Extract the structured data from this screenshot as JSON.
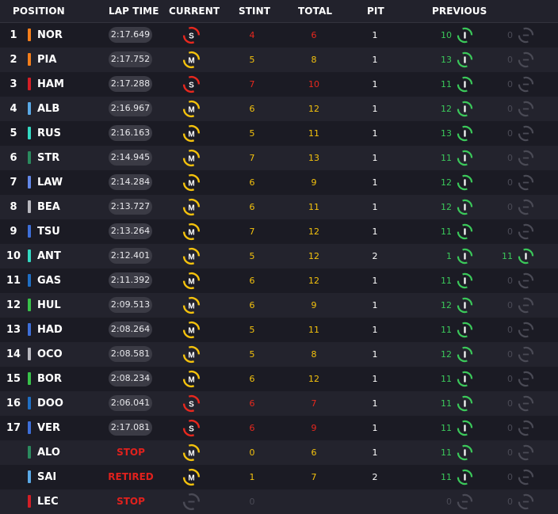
{
  "header": {
    "position": "POSITION",
    "lap_time": "LAP TIME",
    "current": "CURRENT",
    "stint": "STINT",
    "total": "TOTAL",
    "pit": "PIT",
    "previous": "PREVIOUS"
  },
  "colors": {
    "soft": "#e8281e",
    "medium": "#f4c20d",
    "inter": "#3bc85a",
    "dim": "#4a4a55"
  },
  "rows": [
    {
      "pos": "1",
      "code": "NOR",
      "team_color": "#f47e1b",
      "lap": "2:17.649",
      "tyre": "S",
      "stint": "4",
      "total": "6",
      "pit": "1",
      "p1_lap": "10",
      "p1_tyre": "I",
      "p2_lap": "0",
      "p2_tyre": ""
    },
    {
      "pos": "2",
      "code": "PIA",
      "team_color": "#f47e1b",
      "lap": "2:17.752",
      "tyre": "M",
      "stint": "5",
      "total": "8",
      "pit": "1",
      "p1_lap": "13",
      "p1_tyre": "I",
      "p2_lap": "0",
      "p2_tyre": ""
    },
    {
      "pos": "3",
      "code": "HAM",
      "team_color": "#d31e26",
      "lap": "2:17.288",
      "tyre": "S",
      "stint": "7",
      "total": "10",
      "pit": "1",
      "p1_lap": "11",
      "p1_tyre": "I",
      "p2_lap": "0",
      "p2_tyre": ""
    },
    {
      "pos": "4",
      "code": "ALB",
      "team_color": "#5aa9e6",
      "lap": "2:16.967",
      "tyre": "M",
      "stint": "6",
      "total": "12",
      "pit": "1",
      "p1_lap": "12",
      "p1_tyre": "I",
      "p2_lap": "0",
      "p2_tyre": ""
    },
    {
      "pos": "5",
      "code": "RUS",
      "team_color": "#33d9c2",
      "lap": "2:16.163",
      "tyre": "M",
      "stint": "5",
      "total": "11",
      "pit": "1",
      "p1_lap": "13",
      "p1_tyre": "I",
      "p2_lap": "0",
      "p2_tyre": ""
    },
    {
      "pos": "6",
      "code": "STR",
      "team_color": "#2b8a5e",
      "lap": "2:14.945",
      "tyre": "M",
      "stint": "7",
      "total": "13",
      "pit": "1",
      "p1_lap": "11",
      "p1_tyre": "I",
      "p2_lap": "0",
      "p2_tyre": ""
    },
    {
      "pos": "7",
      "code": "LAW",
      "team_color": "#6388e8",
      "lap": "2:14.284",
      "tyre": "M",
      "stint": "6",
      "total": "9",
      "pit": "1",
      "p1_lap": "12",
      "p1_tyre": "I",
      "p2_lap": "0",
      "p2_tyre": ""
    },
    {
      "pos": "8",
      "code": "BEA",
      "team_color": "#b8b8bf",
      "lap": "2:13.727",
      "tyre": "M",
      "stint": "6",
      "total": "11",
      "pit": "1",
      "p1_lap": "12",
      "p1_tyre": "I",
      "p2_lap": "0",
      "p2_tyre": ""
    },
    {
      "pos": "9",
      "code": "TSU",
      "team_color": "#3e6fd9",
      "lap": "2:13.264",
      "tyre": "M",
      "stint": "7",
      "total": "12",
      "pit": "1",
      "p1_lap": "11",
      "p1_tyre": "I",
      "p2_lap": "0",
      "p2_tyre": ""
    },
    {
      "pos": "10",
      "code": "ANT",
      "team_color": "#33d9c2",
      "lap": "2:12.401",
      "tyre": "M",
      "stint": "5",
      "total": "12",
      "pit": "2",
      "p1_lap": "1",
      "p1_tyre": "I",
      "p2_lap": "11",
      "p2_tyre": "I"
    },
    {
      "pos": "11",
      "code": "GAS",
      "team_color": "#1f6fc4",
      "lap": "2:11.392",
      "tyre": "M",
      "stint": "6",
      "total": "12",
      "pit": "1",
      "p1_lap": "11",
      "p1_tyre": "I",
      "p2_lap": "0",
      "p2_tyre": ""
    },
    {
      "pos": "12",
      "code": "HUL",
      "team_color": "#39c24a",
      "lap": "2:09.513",
      "tyre": "M",
      "stint": "6",
      "total": "9",
      "pit": "1",
      "p1_lap": "12",
      "p1_tyre": "I",
      "p2_lap": "0",
      "p2_tyre": ""
    },
    {
      "pos": "13",
      "code": "HAD",
      "team_color": "#3e6fd9",
      "lap": "2:08.264",
      "tyre": "M",
      "stint": "5",
      "total": "11",
      "pit": "1",
      "p1_lap": "11",
      "p1_tyre": "I",
      "p2_lap": "0",
      "p2_tyre": ""
    },
    {
      "pos": "14",
      "code": "OCO",
      "team_color": "#b8b8bf",
      "lap": "2:08.581",
      "tyre": "M",
      "stint": "5",
      "total": "8",
      "pit": "1",
      "p1_lap": "12",
      "p1_tyre": "I",
      "p2_lap": "0",
      "p2_tyre": ""
    },
    {
      "pos": "15",
      "code": "BOR",
      "team_color": "#39c24a",
      "lap": "2:08.234",
      "tyre": "M",
      "stint": "6",
      "total": "12",
      "pit": "1",
      "p1_lap": "11",
      "p1_tyre": "I",
      "p2_lap": "0",
      "p2_tyre": ""
    },
    {
      "pos": "16",
      "code": "DOO",
      "team_color": "#1f6fc4",
      "lap": "2:06.041",
      "tyre": "S",
      "stint": "6",
      "total": "7",
      "pit": "1",
      "p1_lap": "11",
      "p1_tyre": "I",
      "p2_lap": "0",
      "p2_tyre": ""
    },
    {
      "pos": "17",
      "code": "VER",
      "team_color": "#3e6fd9",
      "lap": "2:17.081",
      "tyre": "S",
      "stint": "6",
      "total": "9",
      "pit": "1",
      "p1_lap": "11",
      "p1_tyre": "I",
      "p2_lap": "0",
      "p2_tyre": ""
    },
    {
      "pos": "",
      "code": "ALO",
      "team_color": "#2b8a5e",
      "lap": "STOP",
      "tyre": "M",
      "stint": "0",
      "total": "6",
      "pit": "1",
      "p1_lap": "11",
      "p1_tyre": "I",
      "p2_lap": "0",
      "p2_tyre": ""
    },
    {
      "pos": "",
      "code": "SAI",
      "team_color": "#5aa9e6",
      "lap": "RETIRED",
      "tyre": "M",
      "stint": "1",
      "total": "7",
      "pit": "2",
      "p1_lap": "11",
      "p1_tyre": "I",
      "p2_lap": "0",
      "p2_tyre": ""
    },
    {
      "pos": "",
      "code": "LEC",
      "team_color": "#d31e26",
      "lap": "STOP",
      "tyre": "",
      "stint": "0",
      "total": "",
      "pit": "",
      "p1_lap": "0",
      "p1_tyre": "",
      "p2_lap": "0",
      "p2_tyre": ""
    }
  ]
}
